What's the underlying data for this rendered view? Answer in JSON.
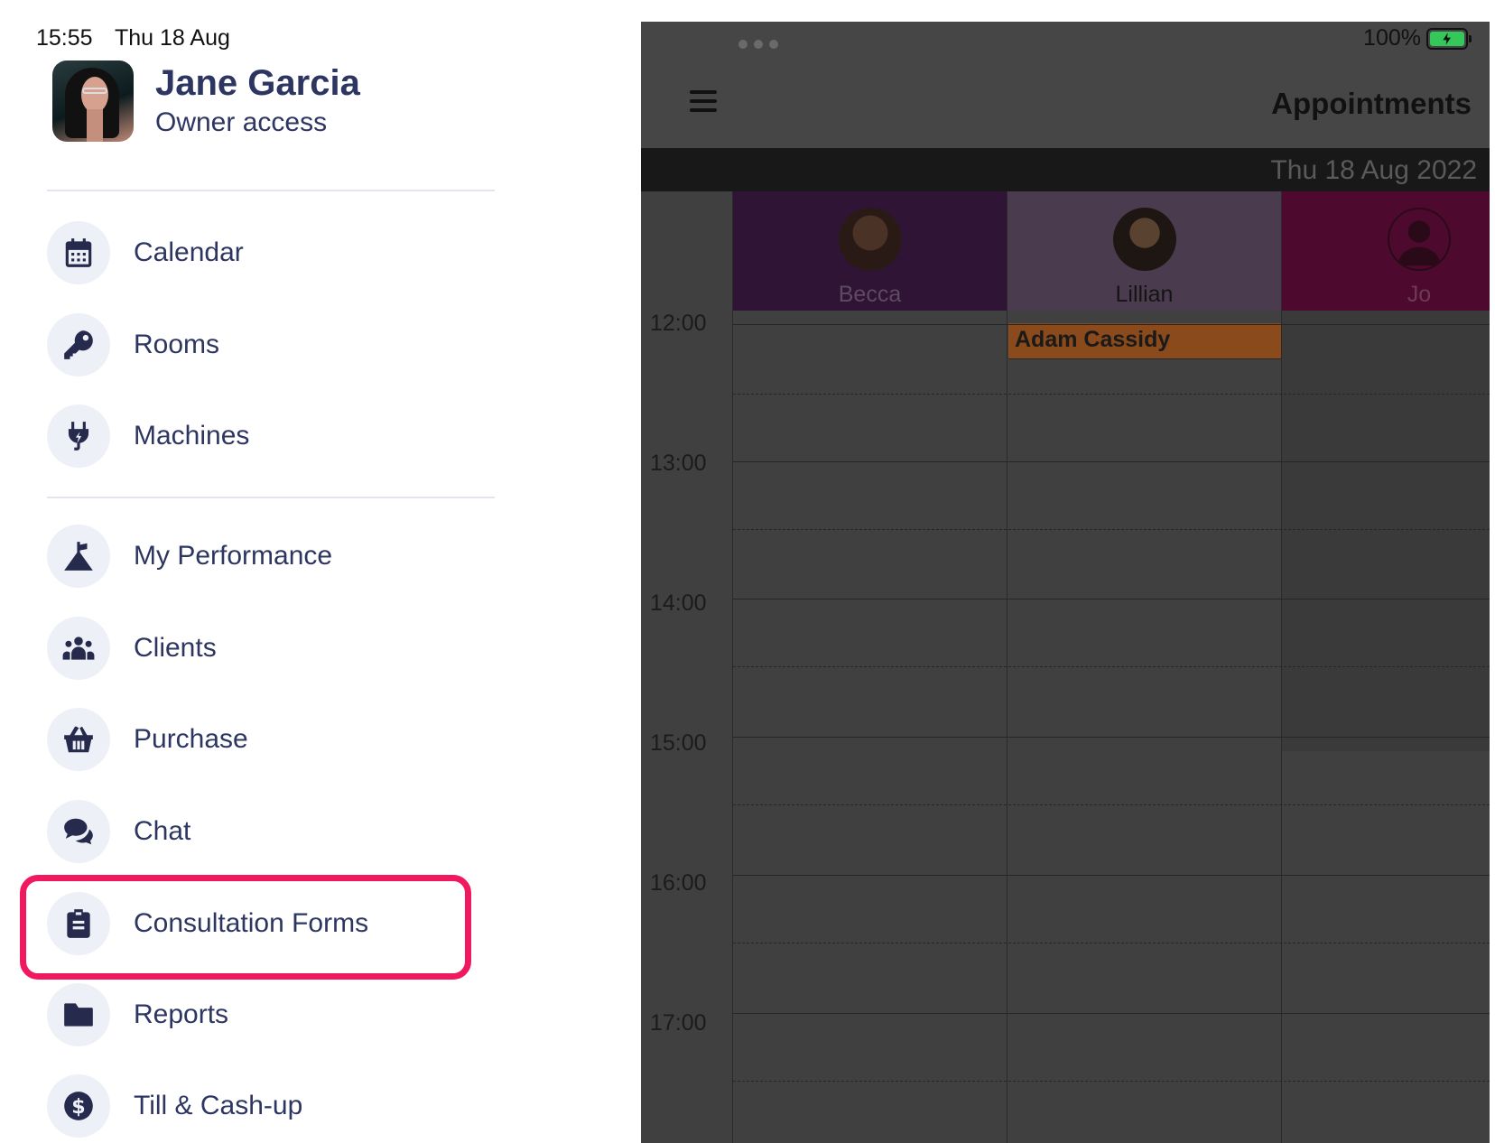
{
  "status_bar": {
    "time": "15:55",
    "date": "Thu 18 Aug",
    "battery": "100%"
  },
  "profile": {
    "name": "Jane Garcia",
    "role": "Owner access"
  },
  "menu": {
    "group1": [
      {
        "label": "Calendar",
        "icon": "calendar-icon"
      },
      {
        "label": "Rooms",
        "icon": "key-icon"
      },
      {
        "label": "Machines",
        "icon": "plug-icon"
      }
    ],
    "group2": [
      {
        "label": "My Performance",
        "icon": "mountain-flag-icon"
      },
      {
        "label": "Clients",
        "icon": "users-icon"
      },
      {
        "label": "Purchase",
        "icon": "basket-icon"
      },
      {
        "label": "Chat",
        "icon": "chat-icon"
      },
      {
        "label": "Consultation Forms",
        "icon": "clipboard-icon",
        "highlighted": true
      },
      {
        "label": "Reports",
        "icon": "folder-icon"
      },
      {
        "label": "Till & Cash-up",
        "icon": "dollar-icon"
      }
    ]
  },
  "appointments_panel": {
    "title": "Appointments",
    "date": "Thu 18 Aug 2022",
    "times": [
      "12:00",
      "13:00",
      "14:00",
      "15:00",
      "16:00",
      "17:00"
    ],
    "staff": [
      {
        "name": "Becca",
        "header_color": "#2f1436",
        "name_color": "#5e4a63"
      },
      {
        "name": "Lillian",
        "header_color": "#4a3b4e",
        "name_color": "#141414"
      },
      {
        "name": "Jo",
        "header_color": "#4e0a2e",
        "name_color": "#6d3a53"
      }
    ],
    "appointment": {
      "client": "Adam Cassidy",
      "staff": "Lillian",
      "start": "12:00",
      "color": "#8a4a1b"
    }
  },
  "colors": {
    "accent": "#2d3561",
    "highlight": "#f0195f",
    "battery": "#34c759"
  }
}
